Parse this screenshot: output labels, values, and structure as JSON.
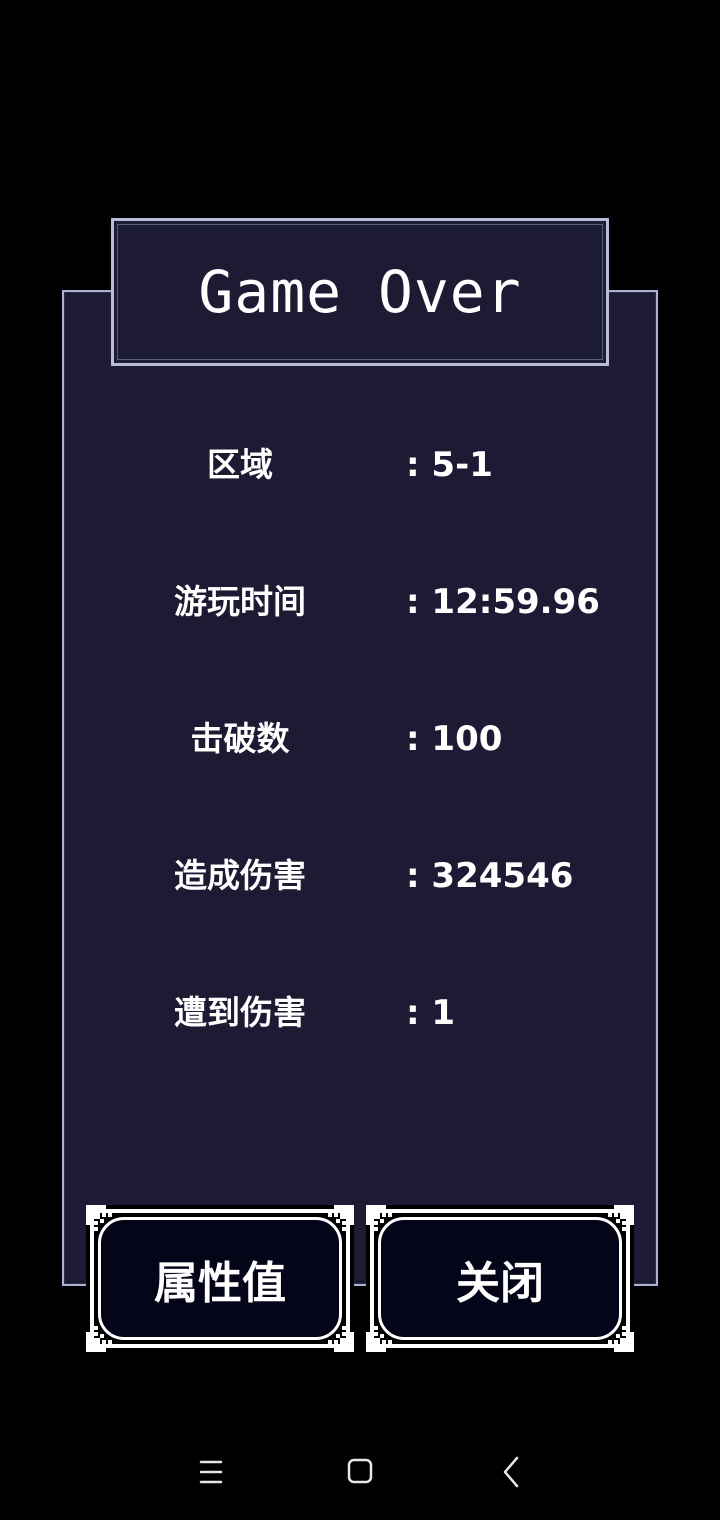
{
  "dialog": {
    "title": "Game Over"
  },
  "stats": [
    {
      "label": "区域",
      "value": ": 5-1"
    },
    {
      "label": "游玩时间",
      "value": ": 12:59.96"
    },
    {
      "label": "击破数",
      "value": ": 100"
    },
    {
      "label": "造成伤害",
      "value": ": 324546"
    },
    {
      "label": "遭到伤害",
      "value": ": 1"
    }
  ],
  "buttons": {
    "attributes_label": "属性值",
    "close_label": "关闭"
  },
  "navbar": {
    "icons": [
      "menu-icon",
      "home-icon",
      "back-icon"
    ]
  },
  "colors": {
    "background": "#000000",
    "panel": "#1c1b33",
    "border": "#aeb0d0",
    "text": "#ffffff",
    "button_fill": "#05051a"
  }
}
